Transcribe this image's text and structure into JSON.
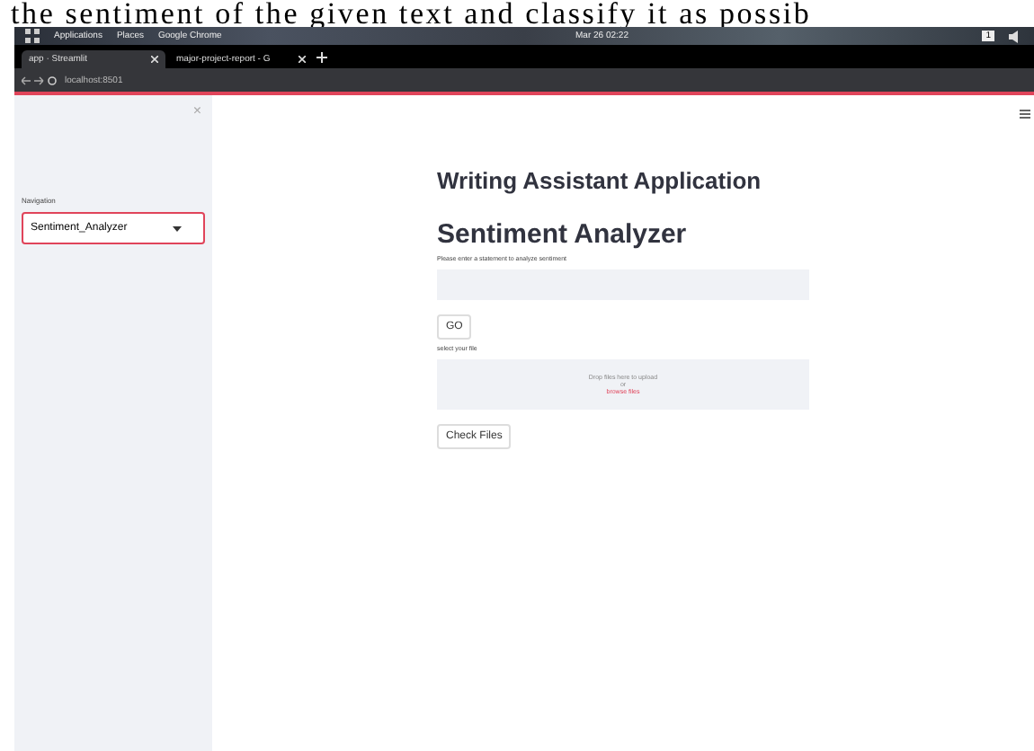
{
  "document_text": "the sentiment of the given text and classify it as possib",
  "system_bar": {
    "menus": [
      "Applications",
      "Places",
      "Google Chrome"
    ],
    "clock": "Mar 26 02:22",
    "workspace": "1"
  },
  "tabs": [
    {
      "title": "app · Streamlit",
      "selected": true
    },
    {
      "title": "major-project-report - G",
      "selected": false
    }
  ],
  "address": "localhost:8501",
  "sidebar": {
    "label": "Navigation",
    "select_value": "Sentiment_Analyzer",
    "close": "×"
  },
  "main": {
    "app_title": "Writing Assistant Application",
    "page_title": "Sentiment Analyzer",
    "input_label": "Please enter a statement to analyze sentiment",
    "go_button": "GO",
    "file_label": "select your file",
    "drop_text": "Drop files here to upload",
    "drop_or": "or",
    "browse_link": "browse files",
    "check_button": "Check Files"
  }
}
